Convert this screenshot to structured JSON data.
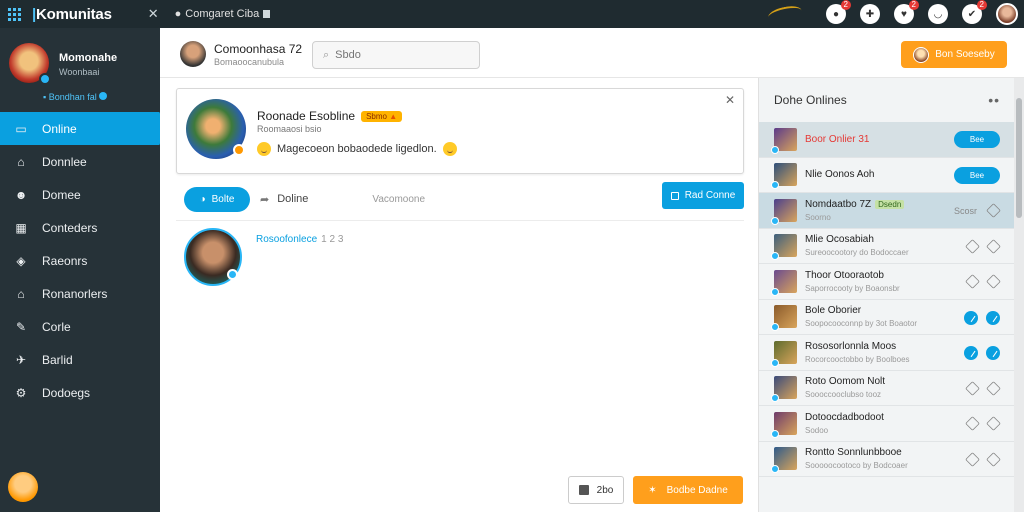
{
  "app": {
    "brand": "Komunitas",
    "tab_label": "Comgaret Ciba"
  },
  "topbar": {
    "icons": [
      {
        "name": "notification-icon",
        "badge": "2"
      },
      {
        "name": "message-icon",
        "badge": ""
      },
      {
        "name": "gift-icon",
        "badge": "2"
      },
      {
        "name": "emoji-icon",
        "badge": ""
      },
      {
        "name": "like-icon",
        "badge": "2"
      }
    ]
  },
  "sidebar": {
    "profile": {
      "name": "Momonahe",
      "sub": "Woonbaai",
      "status": "Bondhan fal"
    },
    "items": [
      {
        "label": "Online",
        "icon": "screen-icon",
        "active": true
      },
      {
        "label": "Donnlee",
        "icon": "home-icon",
        "active": false
      },
      {
        "label": "Domee",
        "icon": "users-icon",
        "active": false
      },
      {
        "label": "Conteders",
        "icon": "calendar-icon",
        "active": false
      },
      {
        "label": "Raeonrs",
        "icon": "tag-icon",
        "active": false
      },
      {
        "label": "Ronanorlers",
        "icon": "home-alt-icon",
        "active": false
      },
      {
        "label": "Corle",
        "icon": "tool-icon",
        "active": false
      },
      {
        "label": "Barlid",
        "icon": "pin-icon",
        "active": false
      },
      {
        "label": "Dodoegs",
        "icon": "settings-icon",
        "active": false
      }
    ]
  },
  "header": {
    "title": "Comoonhasa 72",
    "subtitle": "Bomaoocanubula",
    "search_placeholder": "Sbdo",
    "button_label": "Bon Soeseby"
  },
  "card": {
    "title": "Roonade Esobline",
    "tag": "Sbmo",
    "subtitle": "Roomaaosi bsio",
    "message": "Magecoeon bobaodede ligedlon."
  },
  "actions": {
    "primary_pill": "Bolte",
    "link": "Doline",
    "muted": "Vacomoone",
    "right_button": "Rad Conne"
  },
  "post": {
    "label": "Rosoofonlece",
    "number": "1 2 3"
  },
  "footer": {
    "secondary": "2bo",
    "primary": "Bodbe Dadne"
  },
  "right_panel": {
    "title": "Dohe Onlines",
    "items": [
      {
        "name": "Boor Onlier 31",
        "sub": "",
        "red": true,
        "tag": "",
        "pill": "Bee",
        "label": "",
        "icons": [],
        "thumb": "#5b3a8a"
      },
      {
        "name": "Nlie Oonos Aoh",
        "sub": "",
        "red": false,
        "tag": "",
        "pill": "Bee",
        "label": "",
        "icons": [],
        "thumb": "#2d4f7a"
      },
      {
        "name": "Nomdaatbo 7Z",
        "sub": "Soorno",
        "red": false,
        "tag": "Dsedn",
        "pill": "",
        "label": "Scosr",
        "icons": [
          "outline"
        ],
        "thumb": "#4a3f8c"
      },
      {
        "name": "Mlie Ocosabiah",
        "sub": "Sureoocootory do Bodoccaer",
        "red": false,
        "tag": "",
        "pill": "",
        "label": "",
        "icons": [
          "outline",
          "outline"
        ],
        "thumb": "#3c5f7d"
      },
      {
        "name": "Thoor Otooraotob",
        "sub": "Saporrocooty by Boaonsbr",
        "red": false,
        "tag": "",
        "pill": "",
        "label": "",
        "icons": [
          "outline",
          "outline"
        ],
        "thumb": "#6a4a8f"
      },
      {
        "name": "Bole Oborier",
        "sub": "Soopocooconnp by 3ot Boaotor",
        "red": false,
        "tag": "",
        "pill": "",
        "label": "",
        "icons": [
          "blue",
          "blue"
        ],
        "thumb": "#8a5a2b"
      },
      {
        "name": "Rososorlonnla Moos",
        "sub": "Rocorcooctobbo by Boolboes",
        "red": false,
        "tag": "",
        "pill": "",
        "label": "",
        "icons": [
          "blue",
          "blue"
        ],
        "thumb": "#5d6b2e"
      },
      {
        "name": "Roto Oomom Nolt",
        "sub": "Soooccooclubso tooz",
        "red": false,
        "tag": "",
        "pill": "",
        "label": "",
        "icons": [
          "outline",
          "outline"
        ],
        "thumb": "#3a4a7a"
      },
      {
        "name": "Dotoocdadbodoot",
        "sub": "Sodoo",
        "red": false,
        "tag": "",
        "pill": "",
        "label": "",
        "icons": [
          "outline",
          "outline"
        ],
        "thumb": "#6e3b6b"
      },
      {
        "name": "Rontto Sonnlunbbooe",
        "sub": "Sooooocootoco by Bodcoaer",
        "red": false,
        "tag": "",
        "pill": "",
        "label": "",
        "icons": [
          "outline",
          "outline"
        ],
        "thumb": "#2e5a8a"
      }
    ]
  },
  "colors": {
    "topbar": "#1f2b30",
    "sidebar": "#263238",
    "accent_blue": "#0aa0e0",
    "accent_orange": "#ff9f1c"
  }
}
